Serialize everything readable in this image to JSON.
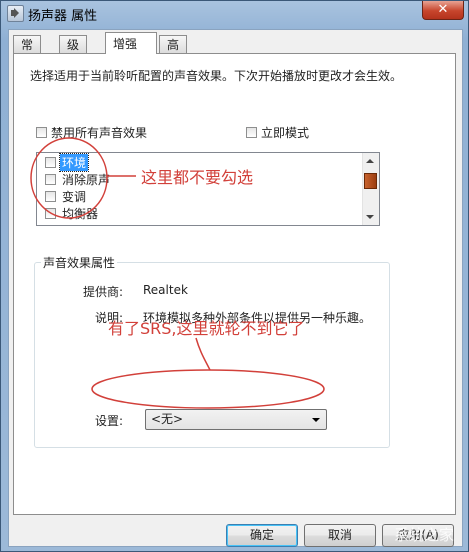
{
  "window": {
    "title": "扬声器 属性",
    "close_label": "✕"
  },
  "tabs": [
    {
      "label": "常规"
    },
    {
      "label": "级别"
    },
    {
      "label": "增强",
      "active": true
    },
    {
      "label": "高级"
    }
  ],
  "enhancements": {
    "description": "选择适用于当前聆听配置的声音效果。下次开始播放时更改才会生效。",
    "disable_all_label": "禁用所有声音效果",
    "immediate_mode_label": "立即模式",
    "effects": [
      {
        "label": "环境",
        "selected": true
      },
      {
        "label": "消除原声"
      },
      {
        "label": "变调"
      },
      {
        "label": "均衡器"
      }
    ]
  },
  "properties": {
    "group_title": "声音效果属性",
    "provider_label": "提供商:",
    "provider_value": "Realtek",
    "description_label": "说明:",
    "description_value": "环境模拟多种外部条件以提供另一种乐趣。",
    "settings_label": "设置:",
    "settings_value": "<无>"
  },
  "buttons": {
    "ok_label": "确定",
    "cancel_label": "取消",
    "apply_label": "应用(A)"
  },
  "annotations": {
    "list_note": "这里都不要勾选",
    "srs_note": "有了SRS,这里就轮不到它了",
    "color": "#d2403a"
  },
  "watermark": "系统之家"
}
